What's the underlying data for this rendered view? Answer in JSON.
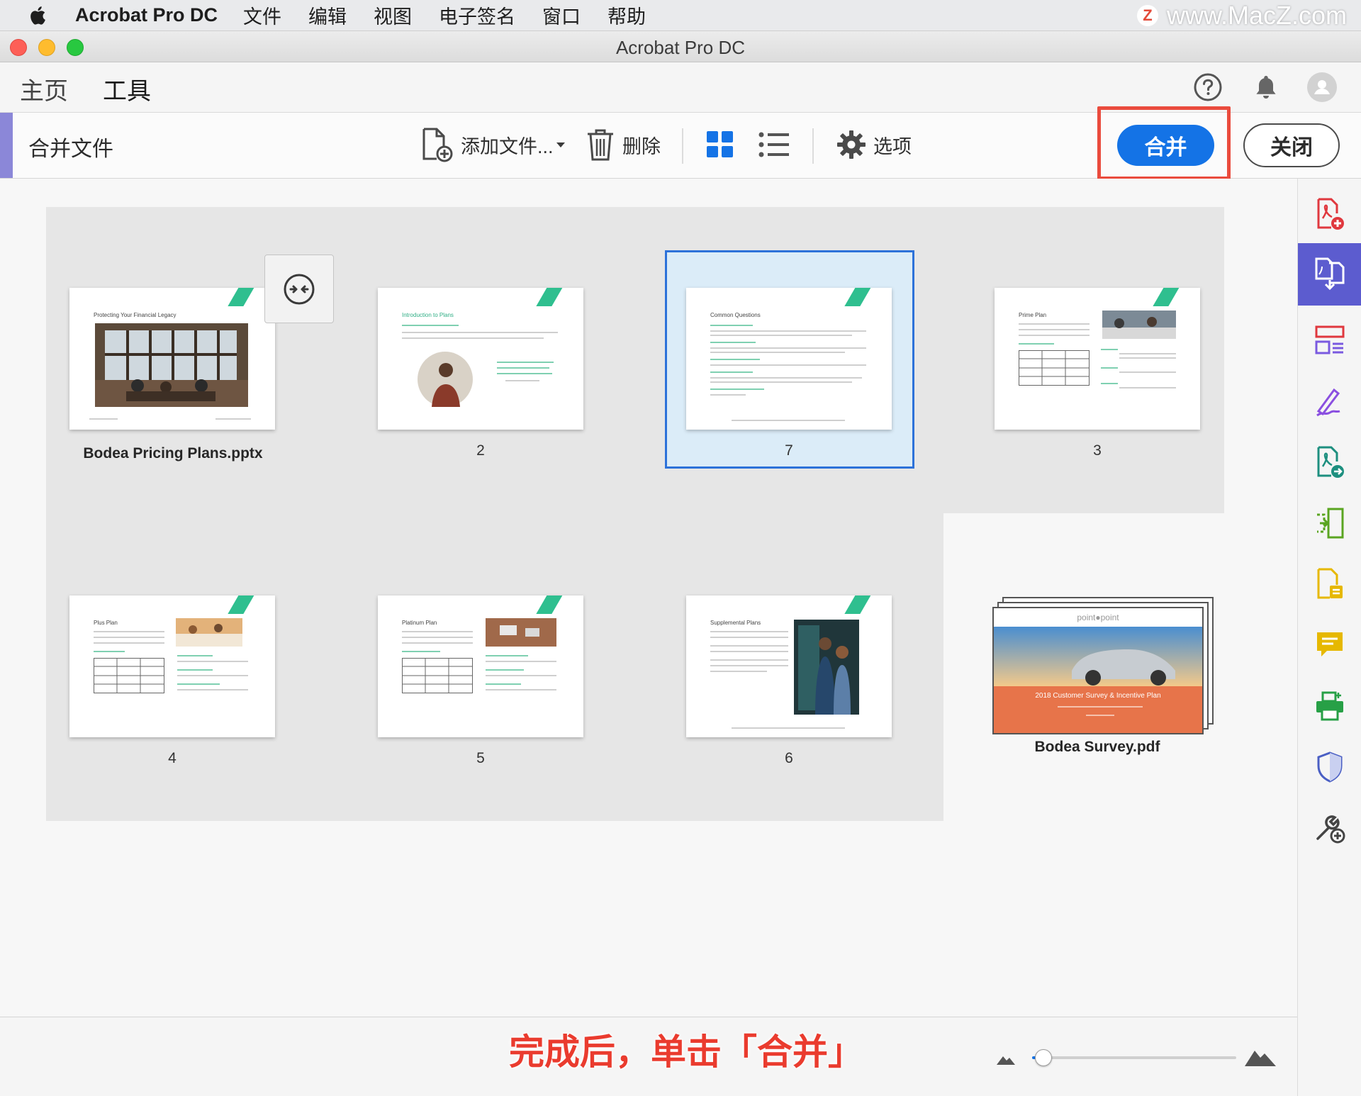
{
  "menubar": {
    "app_name": "Acrobat Pro DC",
    "items": [
      "文件",
      "编辑",
      "视图",
      "电子签名",
      "窗口",
      "帮助"
    ],
    "watermark": "www.MacZ.com",
    "watermark_badge": "Z"
  },
  "window": {
    "title": "Acrobat Pro DC"
  },
  "tabs": {
    "home": "主页",
    "tools": "工具"
  },
  "header_icons": [
    "help-icon",
    "bell-icon",
    "account-icon"
  ],
  "toolbar": {
    "tool_title": "合并文件",
    "add_files": "添加文件...",
    "delete": "删除",
    "options": "选项",
    "merge": "合并",
    "close": "关闭"
  },
  "pages": [
    {
      "caption": "Bodea Pricing Plans.pptx",
      "title": "Protecting Your Financial Legacy"
    },
    {
      "caption": "2",
      "title": "Introduction to Plans"
    },
    {
      "caption": "7",
      "title": "Common Questions"
    },
    {
      "caption": "3",
      "title": "Prime Plan"
    },
    {
      "caption": "4",
      "title": "Plus Plan"
    },
    {
      "caption": "5",
      "title": "Platinum Plan"
    },
    {
      "caption": "6",
      "title": "Supplemental Plans"
    }
  ],
  "survey": {
    "caption": "Bodea Survey.pdf",
    "brand": "point●point",
    "banner": "2018 Customer Survey & Incentive Plan"
  },
  "instruction": "完成后，单击「合并」",
  "colors": {
    "accent": "#1473e6",
    "highlight": "#ea4b3d",
    "rail_active": "#5c5ccf"
  },
  "zoom": {
    "level": 0.06
  }
}
